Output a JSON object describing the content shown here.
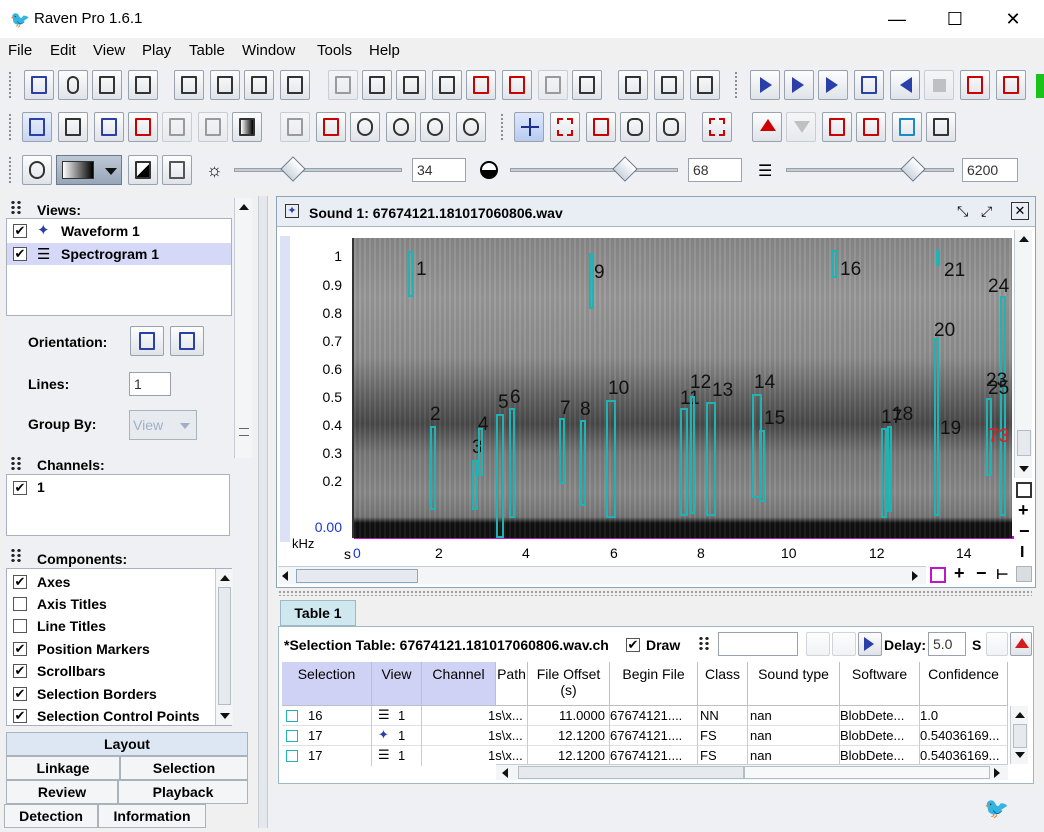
{
  "window": {
    "title": "Raven Pro 1.6.1",
    "minimize": "—",
    "maximize": "☐",
    "close": "✕"
  },
  "menu": [
    "File",
    "Edit",
    "View",
    "Play",
    "Table",
    "Window",
    "Tools",
    "Help"
  ],
  "sliders": {
    "brightness": "34",
    "contrast": "68",
    "resolution": "6200"
  },
  "left": {
    "views_title": "Views:",
    "views": [
      "Waveform 1",
      "Spectrogram 1"
    ],
    "orientation_label": "Orientation:",
    "lines_label": "Lines:",
    "lines_value": "1",
    "groupby_label": "Group By:",
    "groupby_value": "View",
    "channels_title": "Channels:",
    "channels": [
      "1"
    ],
    "components_title": "Components:",
    "components": [
      {
        "label": "Axes",
        "checked": true
      },
      {
        "label": "Axis Titles",
        "checked": false
      },
      {
        "label": "Line Titles",
        "checked": false
      },
      {
        "label": "Position Markers",
        "checked": true
      },
      {
        "label": "Scrollbars",
        "checked": true
      },
      {
        "label": "Selection Borders",
        "checked": true
      },
      {
        "label": "Selection Control Points",
        "checked": true
      }
    ],
    "tabs": [
      "Layout",
      "Linkage",
      "Selection",
      "Review",
      "Playback",
      "Detection",
      "Information"
    ]
  },
  "sound": {
    "title": "Sound 1: 67674121.181017060806.wav",
    "y_ticks": [
      "1",
      "0.9",
      "0.8",
      "0.7",
      "0.6",
      "0.5",
      "0.4",
      "0.3",
      "0.2",
      "0.00"
    ],
    "y_unit": "kHz",
    "x_unit": "s",
    "x_ticks": [
      "0",
      "2",
      "4",
      "6",
      "8",
      "10",
      "12",
      "14"
    ],
    "selections": [
      "1",
      "2",
      "3",
      "4",
      "5",
      "6",
      "7",
      "8",
      "9",
      "10",
      "11",
      "12",
      "13",
      "14",
      "15",
      "16",
      "17",
      "18",
      "19",
      "20",
      "21",
      "23",
      "24",
      "25",
      "73"
    ]
  },
  "table": {
    "tab": "Table 1",
    "name": "*Selection Table: 67674121.181017060806.wav.ch",
    "draw_label": "Draw",
    "delay_label": "Delay:",
    "delay_value": "5.0",
    "delay_unit": "S",
    "columns": [
      "Selection",
      "View",
      "Channel",
      "Path",
      "File Offset (s)",
      "Begin File",
      "Class",
      "Sound type",
      "Software",
      "Confidence"
    ],
    "rows": [
      {
        "sel": "16",
        "view": "1",
        "path": "1s\\x...",
        "offset": "11.0000",
        "file": "67674121....",
        "class": "NN",
        "type": "nan",
        "soft": "BlobDete...",
        "conf": "1.0"
      },
      {
        "sel": "17",
        "view": "1",
        "path": "1s\\x...",
        "offset": "12.1200",
        "file": "67674121....",
        "class": "FS",
        "type": "nan",
        "soft": "BlobDete...",
        "conf": "0.54036169..."
      },
      {
        "sel": "17",
        "view": "1",
        "path": "1s\\x...",
        "offset": "12.1200",
        "file": "67674121....",
        "class": "FS",
        "type": "nan",
        "soft": "BlobDete...",
        "conf": "0.54036169..."
      }
    ]
  }
}
